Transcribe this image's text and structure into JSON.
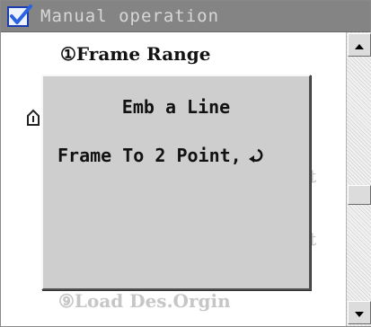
{
  "window": {
    "title": "Manual operation",
    "icon": "checkbox-icon"
  },
  "menu": {
    "item_1": "①Frame Range",
    "item_faded_1": "t",
    "item_faded_2": "t",
    "item_bottom": "⑨Load Des.Orgin"
  },
  "dialog": {
    "line_1": "Emb a Line",
    "line_2": "Frame To 2 Point,",
    "enter_icon": "enter-icon"
  },
  "side_icon": "cursor-icon",
  "scrollbar": {
    "up_icon": "arrow-up-icon",
    "down_icon": "arrow-down-icon"
  },
  "colors": {
    "titlebar": "#848484",
    "dialog_bg": "#cecece",
    "faded_text": "#c6c6c6"
  }
}
